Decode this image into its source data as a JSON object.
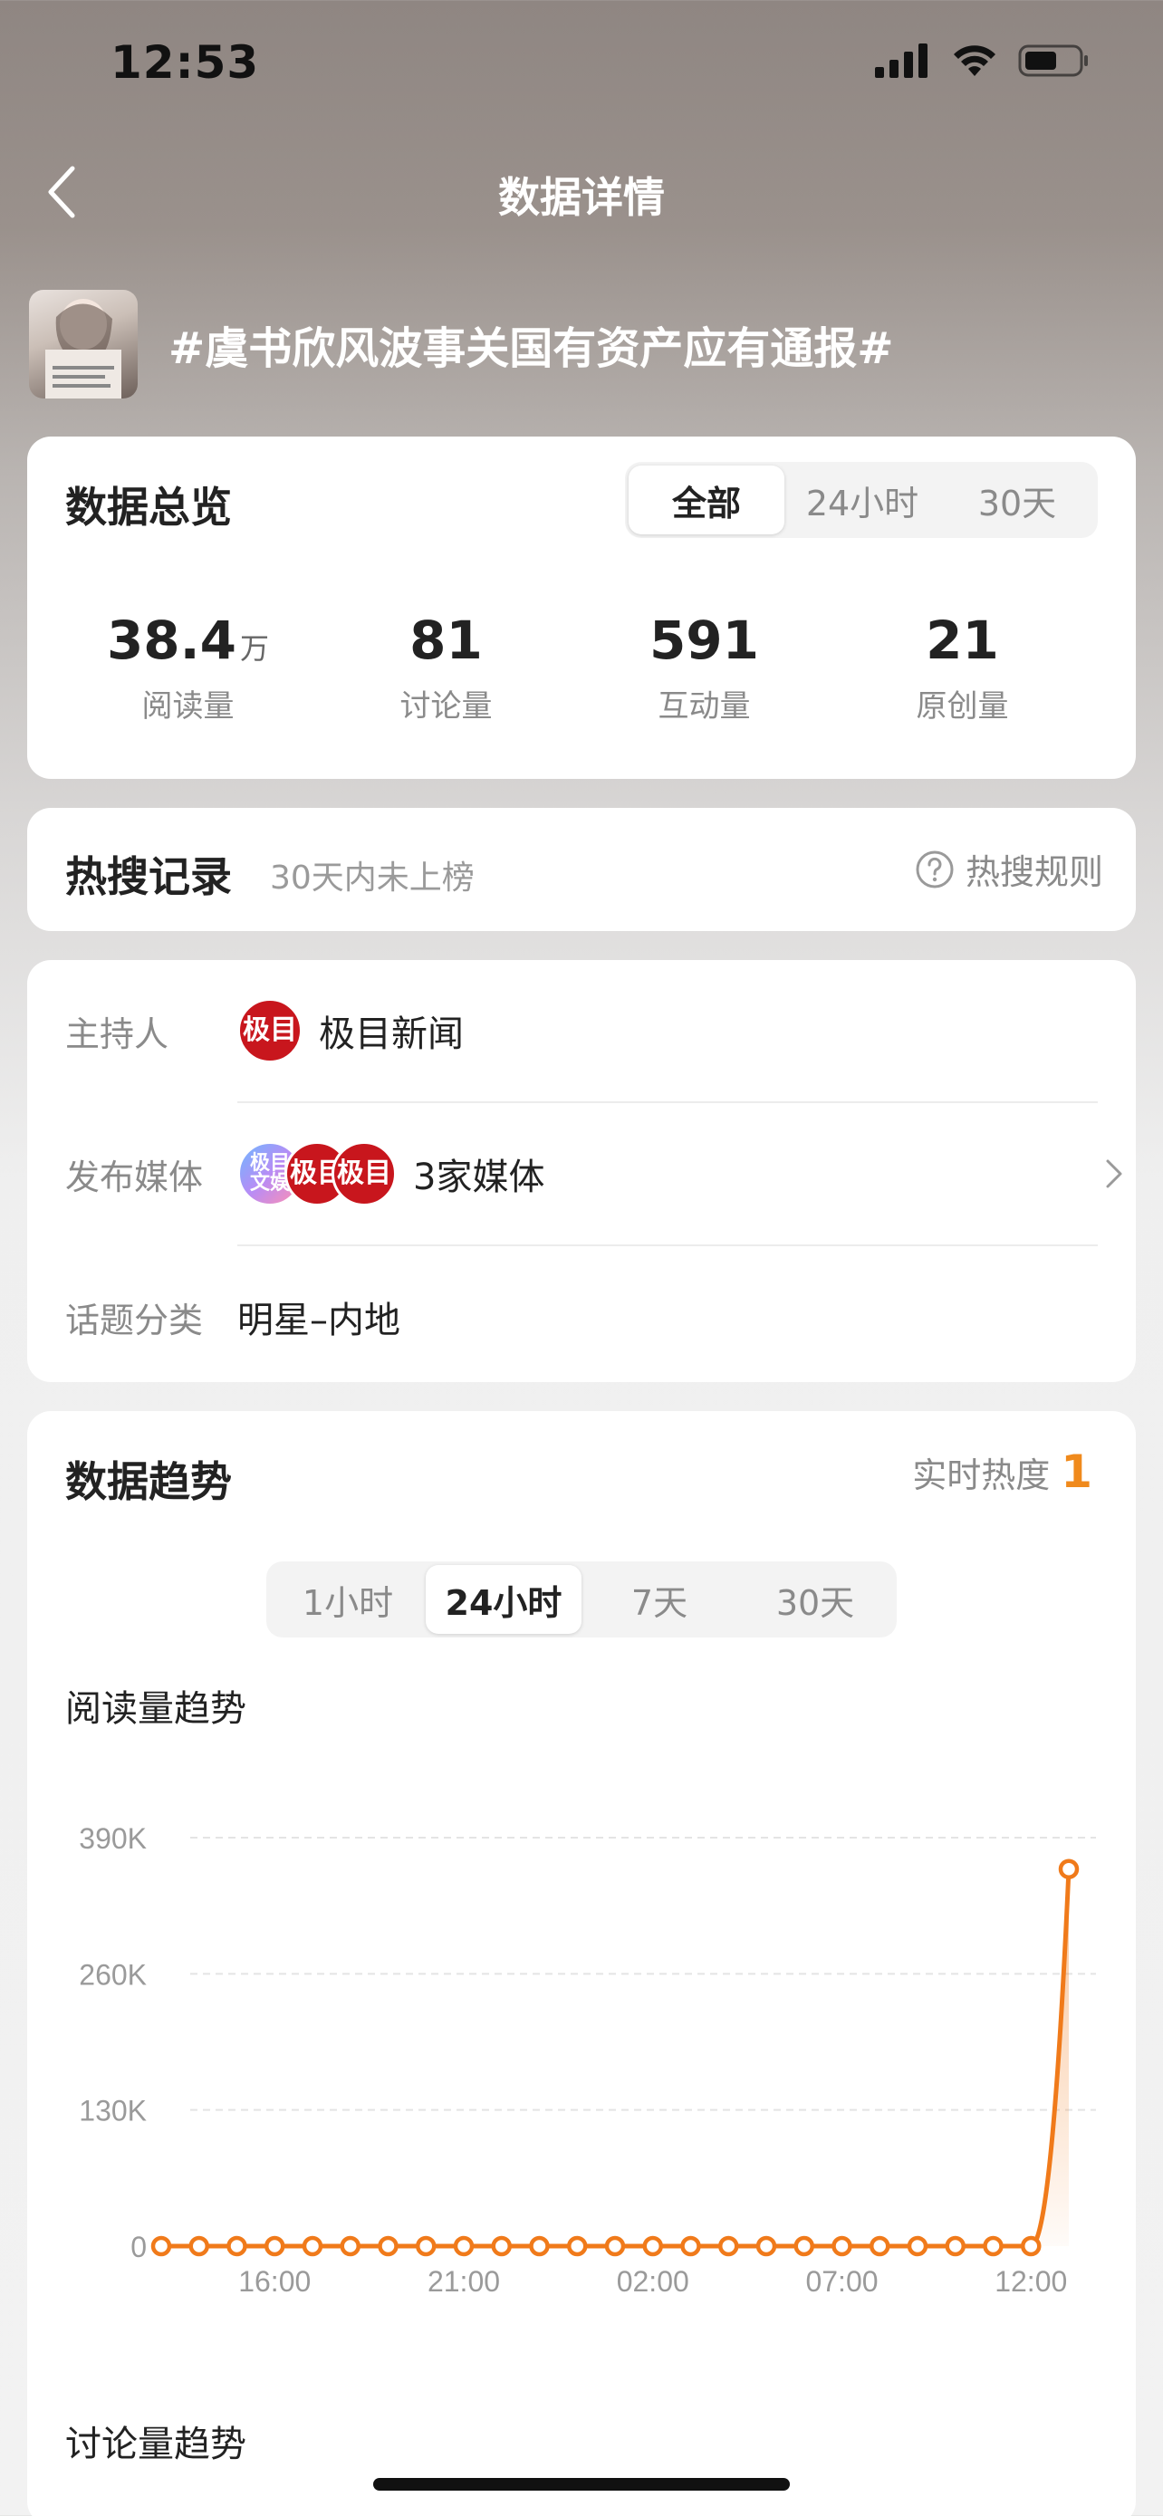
{
  "status_bar": {
    "time": "12:53"
  },
  "nav": {
    "title": "数据详情"
  },
  "topic": {
    "title": "#虞书欣风波事关国有资产应有通报#"
  },
  "overview": {
    "title": "数据总览",
    "tabs": [
      "全部",
      "24小时",
      "30天"
    ],
    "active_tab": 0,
    "stats": [
      {
        "value": "38.4",
        "unit": "万",
        "label": "阅读量"
      },
      {
        "value": "81",
        "unit": "",
        "label": "讨论量"
      },
      {
        "value": "591",
        "unit": "",
        "label": "互动量"
      },
      {
        "value": "21",
        "unit": "",
        "label": "原创量"
      }
    ]
  },
  "hot_record": {
    "title": "热搜记录",
    "subtitle": "30天内未上榜",
    "rules_label": "热搜规则"
  },
  "info": {
    "host_label": "主持人",
    "host_logo_text": "极目",
    "host_value": "极目新闻",
    "media_label": "发布媒体",
    "media_logos": [
      "极目\n文娱",
      "极目",
      "极目"
    ],
    "media_value": "3家媒体",
    "category_label": "话题分类",
    "category_value": "明星–内地"
  },
  "trend": {
    "title": "数据趋势",
    "realtime_label": "实时热度",
    "realtime_value": "1",
    "tabs": [
      "1小时",
      "24小时",
      "7天",
      "30天"
    ],
    "active_tab": 1,
    "reads_title": "阅读量趋势",
    "discussion_title": "讨论量趋势"
  },
  "colors": {
    "accent": "#f08a1c",
    "line": "#f07a1a"
  },
  "chart_data": {
    "type": "line",
    "title": "阅读量趋势",
    "y_ticks": [
      "0",
      "130K",
      "260K",
      "390K"
    ],
    "ylim": [
      0,
      390000
    ],
    "x_tick_labels": [
      "16:00",
      "21:00",
      "02:00",
      "07:00",
      "12:00"
    ],
    "series": [
      {
        "values": [
          0,
          0,
          0,
          0,
          0,
          0,
          0,
          0,
          0,
          0,
          0,
          0,
          0,
          0,
          0,
          0,
          0,
          0,
          0,
          0,
          0,
          0,
          0,
          0,
          360000
        ]
      }
    ],
    "grid": true
  }
}
